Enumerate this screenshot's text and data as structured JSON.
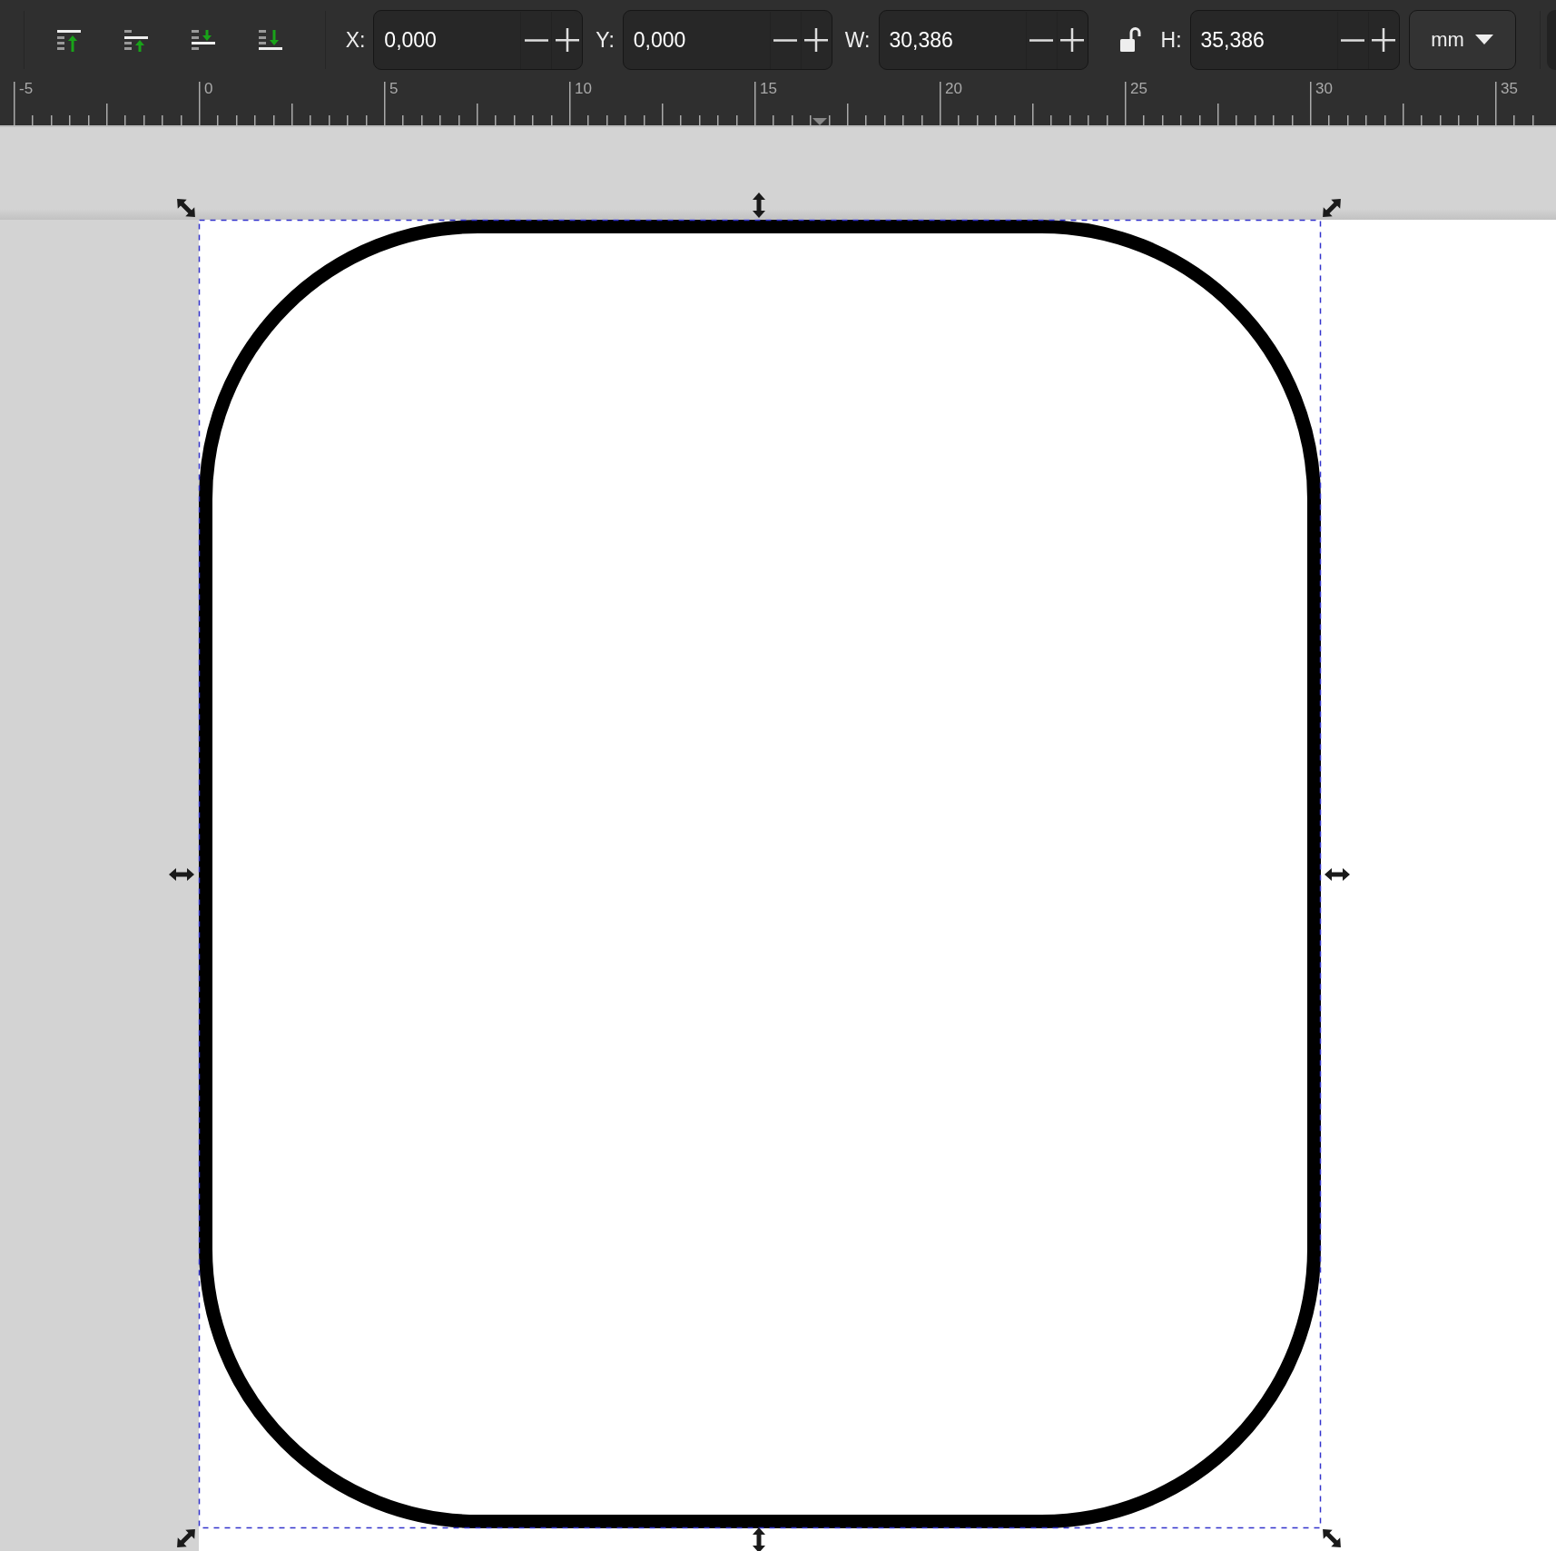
{
  "toolbar": {
    "z_order_buttons": [
      {
        "kind": "top"
      },
      {
        "kind": "up"
      },
      {
        "kind": "down"
      },
      {
        "kind": "bottom"
      }
    ],
    "items": [
      {
        "kind": "field",
        "label": "X:",
        "value": "0,000"
      },
      {
        "kind": "field",
        "label": "Y:",
        "value": "0,000"
      },
      {
        "kind": "field",
        "label": "W:",
        "value": "30,386"
      },
      {
        "kind": "lock",
        "locked": false
      },
      {
        "kind": "field",
        "label": "H:",
        "value": "35,386"
      }
    ],
    "unit": "mm"
  },
  "ruler": {
    "labels": [
      "-5",
      "0",
      "5",
      "10",
      "15",
      "20",
      "25",
      "30",
      "35"
    ]
  }
}
